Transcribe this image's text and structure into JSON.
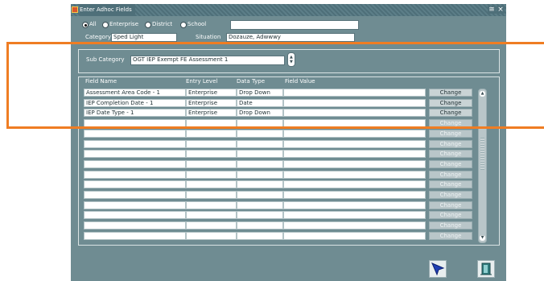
{
  "window": {
    "title": "Enter Adhoc Fields",
    "controls": [
      "≅",
      "×"
    ]
  },
  "scope": {
    "options": [
      {
        "label": "All",
        "selected": true
      },
      {
        "label": "Enterprise",
        "selected": false
      },
      {
        "label": "District",
        "selected": false
      },
      {
        "label": "School",
        "selected": false
      }
    ],
    "school_value": ""
  },
  "category": {
    "label": "Category",
    "value": "Sped Light"
  },
  "situation": {
    "label": "Situation",
    "value": "Dozauze, Adwwwy"
  },
  "sub_category": {
    "label": "Sub Category",
    "value": "OGT IEP Exempt FE Assessment 1"
  },
  "table": {
    "headers": [
      "Field Name",
      "Entry Level",
      "Data Type",
      "Field Value"
    ],
    "change_label": "Change",
    "rows": [
      [
        "Assessment Area Code - 1",
        "Enterprise",
        "Drop Down",
        ""
      ],
      [
        "IEP Completion Date - 1",
        "Enterprise",
        "Date",
        ""
      ],
      [
        "IEP Date Type - 1",
        "Enterprise",
        "Drop Down",
        ""
      ],
      [
        "",
        "",
        "",
        ""
      ],
      [
        "",
        "",
        "",
        ""
      ],
      [
        "",
        "",
        "",
        ""
      ],
      [
        "",
        "",
        "",
        ""
      ],
      [
        "",
        "",
        "",
        ""
      ],
      [
        "",
        "",
        "",
        ""
      ],
      [
        "",
        "",
        "",
        ""
      ],
      [
        "",
        "",
        "",
        ""
      ],
      [
        "",
        "",
        "",
        ""
      ],
      [
        "",
        "",
        "",
        ""
      ],
      [
        "",
        "",
        "",
        ""
      ],
      [
        "",
        "",
        "",
        ""
      ]
    ],
    "enabled_rows": 3
  },
  "colors": {
    "window_bg": "#6f8c92",
    "highlight": "#ef7d23"
  },
  "icons": {
    "action": "arrow-cursor-icon",
    "exit": "exit-door-icon"
  }
}
